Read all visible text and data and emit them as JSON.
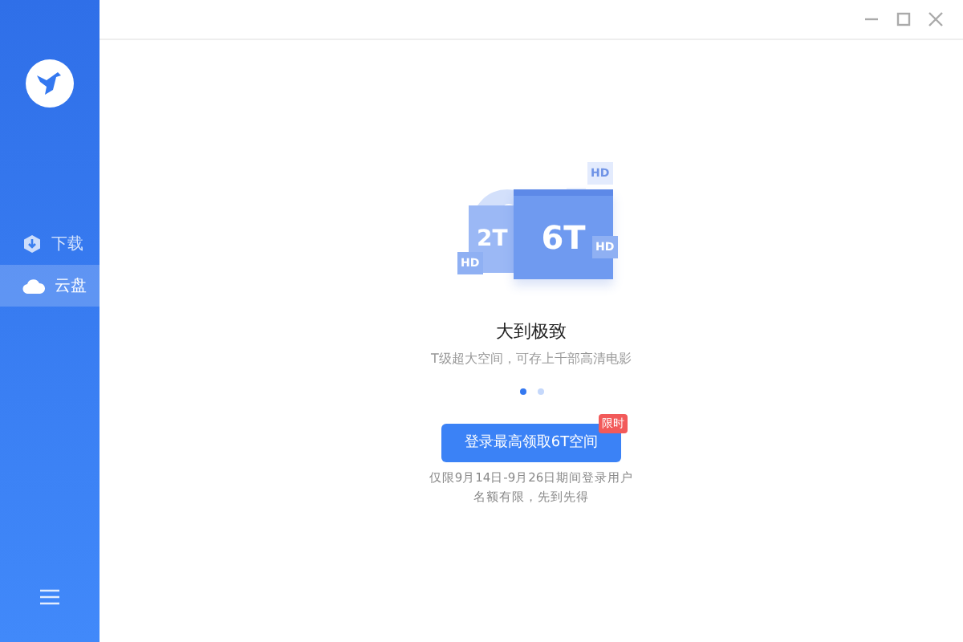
{
  "sidebar": {
    "items": [
      {
        "label": "下载",
        "kind": "download",
        "selected": false
      },
      {
        "label": "云盘",
        "kind": "cloud",
        "selected": true
      }
    ]
  },
  "illustration": {
    "small_folder": "2T",
    "big_folder": "6T",
    "tags": [
      "HD",
      "HD",
      "HD"
    ]
  },
  "promo": {
    "title": "大到极致",
    "subtitle": "T级超大空间，可存上千部高清电影",
    "dots": [
      {
        "selected": true
      },
      {
        "selected": false
      }
    ],
    "button": "登录最高领取6T空间",
    "badge": "限时",
    "notes": [
      "仅限9月14日-9月26日期间登录用户",
      "名额有限，先到先得"
    ]
  }
}
